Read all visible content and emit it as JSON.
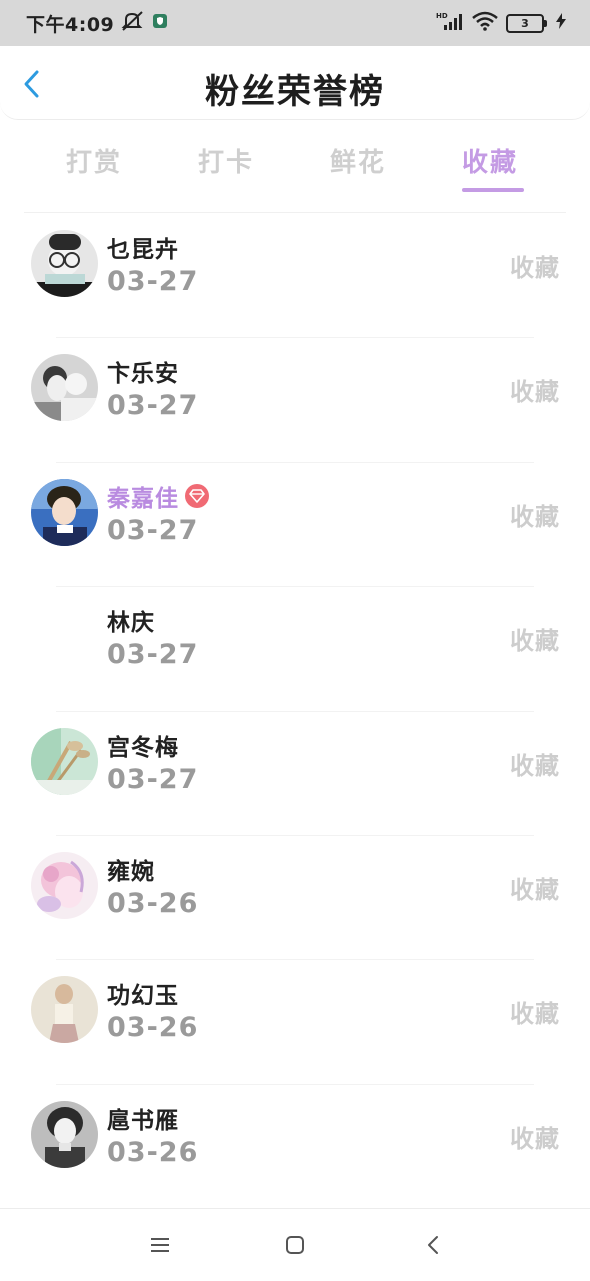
{
  "status_bar": {
    "time": "下午4:09",
    "battery": "3",
    "network": "HD",
    "icons": [
      "mute-icon",
      "shield-app-icon",
      "signal-icon",
      "wifi-icon",
      "battery-icon",
      "charging-icon"
    ]
  },
  "header": {
    "title": "粉丝荣誉榜",
    "back_icon": "chevron-left-icon"
  },
  "tabs": [
    {
      "label": "打赏",
      "active": false
    },
    {
      "label": "打卡",
      "active": false
    },
    {
      "label": "鲜花",
      "active": false
    },
    {
      "label": "收藏",
      "active": true
    }
  ],
  "rows": [
    {
      "name": "乜昆卉",
      "date": "03-27",
      "action": "收藏",
      "vip": false,
      "avatar": "avatar-girl-glasses"
    },
    {
      "name": "卞乐安",
      "date": "03-27",
      "action": "收藏",
      "vip": false,
      "avatar": "avatar-couple"
    },
    {
      "name": "秦嘉佳",
      "date": "03-27",
      "action": "收藏",
      "vip": true,
      "avatar": "avatar-boy-blue"
    },
    {
      "name": "林庆",
      "date": "03-27",
      "action": "收藏",
      "vip": false,
      "avatar": "none"
    },
    {
      "name": "宫冬梅",
      "date": "03-27",
      "action": "收藏",
      "vip": false,
      "avatar": "avatar-flower-green"
    },
    {
      "name": "雍婉",
      "date": "03-26",
      "action": "收藏",
      "vip": false,
      "avatar": "avatar-pink-anime"
    },
    {
      "name": "功幻玉",
      "date": "03-26",
      "action": "收藏",
      "vip": false,
      "avatar": "avatar-girl-beige"
    },
    {
      "name": "扈书雁",
      "date": "03-26",
      "action": "收藏",
      "vip": false,
      "avatar": "avatar-girl-bw"
    }
  ],
  "colors": {
    "accent": "#c49be4",
    "vip_name": "#b98be0",
    "vip_badge": "#f06a74",
    "back_arrow": "#2d9be0",
    "muted_text": "#cdcdcd",
    "date_text": "#9a9a9a"
  },
  "nav_bar": {
    "icons": [
      "menu-icon",
      "home-icon",
      "back-icon"
    ]
  }
}
